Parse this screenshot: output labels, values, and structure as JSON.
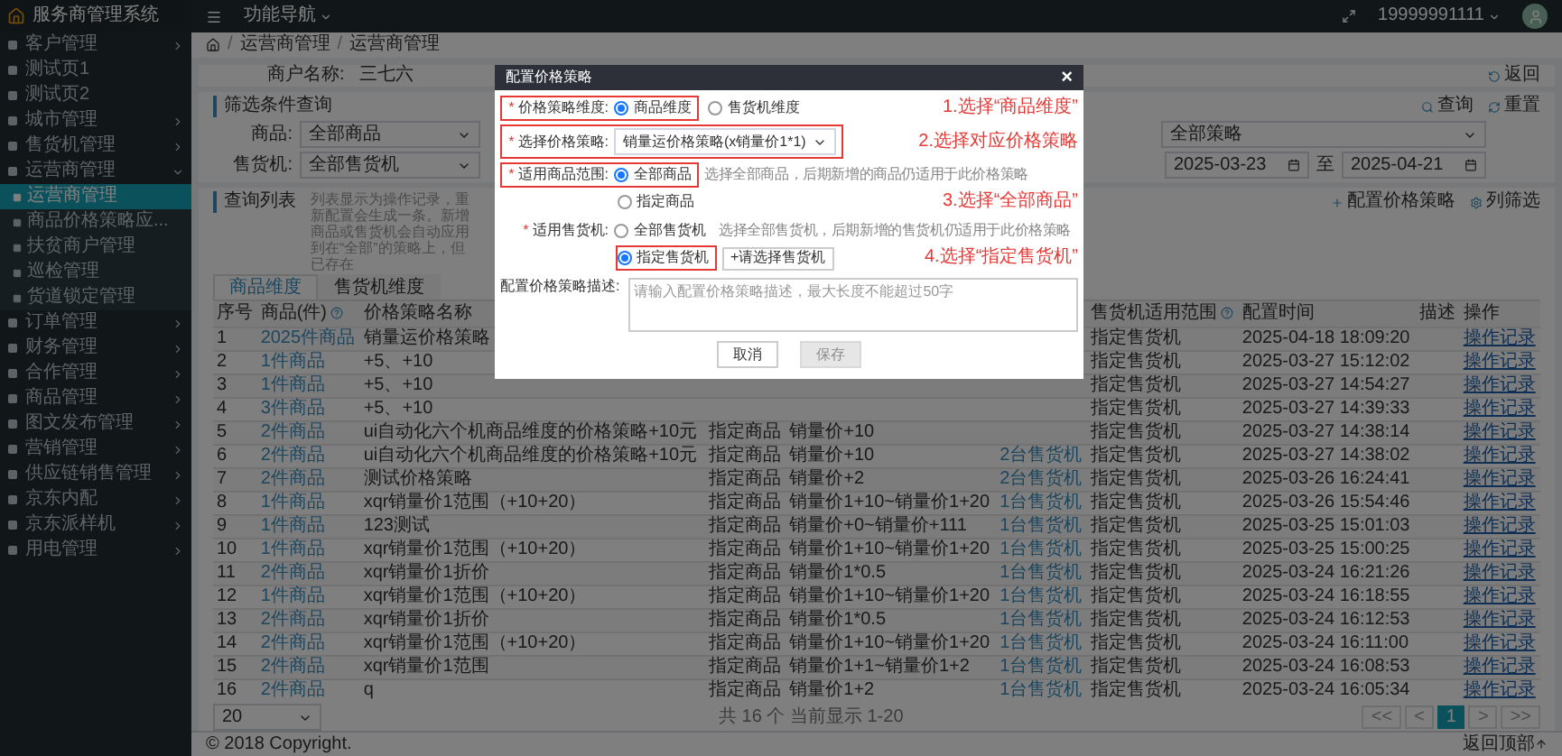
{
  "sidebar": {
    "title": "服务商管理系统",
    "items": [
      {
        "label": "客户管理",
        "selected": false,
        "expanded": false
      },
      {
        "label": "测试页1",
        "selected": false
      },
      {
        "label": "测试页2",
        "selected": false
      },
      {
        "label": "城市管理",
        "selected": false,
        "expanded": false
      },
      {
        "label": "售货机管理",
        "selected": false,
        "expanded": false
      },
      {
        "label": "运营商管理",
        "selected": false,
        "expanded": true,
        "children": [
          {
            "label": "运营商管理",
            "selected": true
          },
          {
            "label": "商品价格策略应...",
            "selected": false
          },
          {
            "label": "扶贫商户管理",
            "selected": false
          },
          {
            "label": "巡检管理",
            "selected": false
          },
          {
            "label": "货道锁定管理",
            "selected": false
          }
        ]
      },
      {
        "label": "订单管理",
        "selected": false,
        "expanded": false
      },
      {
        "label": "财务管理",
        "selected": false,
        "expanded": false
      },
      {
        "label": "合作管理",
        "selected": false,
        "expanded": false
      },
      {
        "label": "商品管理",
        "selected": false,
        "expanded": false
      },
      {
        "label": "图文发布管理",
        "selected": false,
        "expanded": false
      },
      {
        "label": "营销管理",
        "selected": false,
        "expanded": false
      },
      {
        "label": "供应链销售管理",
        "selected": false,
        "expanded": false
      },
      {
        "label": "京东内配",
        "selected": false,
        "expanded": false
      },
      {
        "label": "京东派样机",
        "selected": false,
        "expanded": false
      },
      {
        "label": "用电管理",
        "selected": false,
        "expanded": false
      }
    ]
  },
  "topbar": {
    "nav": "功能导航",
    "user": "19999991111"
  },
  "breadcrumb": [
    {
      "separator": "/",
      "label": "运营商管理"
    },
    {
      "separator": "/",
      "label": "运营商管理"
    }
  ],
  "merchant": {
    "label": "商户名称:",
    "value": "三七六",
    "back": "返回"
  },
  "filter": {
    "title": "筛选条件查询",
    "search": "查询",
    "reset": "重置",
    "goods_label": "商品:",
    "goods": "全部商品",
    "strategy": "全部策略",
    "machine_label": "售货机:",
    "machine": "全部售货机",
    "date_from": "2025-03-23",
    "date_sep": "至",
    "date_to": "2025-04-21"
  },
  "list": {
    "title": "查询列表",
    "note": "列表显示为操作记录，重新配置会生成一条。新增商品或售货机会自动应用到在“全部”的策略上，但已存在",
    "configure": "配置价格策略",
    "columns_button": "列筛选"
  },
  "tabs": [
    {
      "label": "商品维度",
      "selected": true
    },
    {
      "label": "售货机维度",
      "selected": false
    }
  ],
  "table": {
    "columns": [
      {
        "label": "序号",
        "help": false
      },
      {
        "label": "商品(件)",
        "help": true
      },
      {
        "label": "价格策略名称",
        "help": false
      },
      {},
      {},
      {},
      {
        "label": "售货机适用范围",
        "help": true
      },
      {
        "label": "配置时间",
        "help": false
      },
      {
        "label": "描述",
        "help": false
      },
      {
        "label": "操作",
        "help": false
      }
    ],
    "rows": [
      {
        "index": "1",
        "goods": "2025件商品",
        "name": "销量运价格策略",
        "scope": "指定售货机",
        "time": "2025-04-18 18:09:20",
        "action": "操作记录"
      },
      {
        "index": "2",
        "goods": "1件商品",
        "name": "+5、+10",
        "scope": "指定售货机",
        "time": "2025-03-27 15:12:02",
        "action": "操作记录"
      },
      {
        "index": "3",
        "goods": "1件商品",
        "name": "+5、+10",
        "scope": "指定售货机",
        "time": "2025-03-27 14:54:27",
        "action": "操作记录"
      },
      {
        "index": "4",
        "goods": "3件商品",
        "name": "+5、+10",
        "scope": "指定售货机",
        "time": "2025-03-27 14:39:33",
        "action": "操作记录"
      },
      {
        "index": "5",
        "goods": "2件商品",
        "name": "ui自动化六个机商品维度的价格策略+10元",
        "column_4": "指定商品",
        "column_5": "销量价+10",
        "scope": "指定售货机",
        "time": "2025-03-27 14:38:14",
        "action": "操作记录"
      },
      {
        "index": "6",
        "goods": "2件商品",
        "name": "ui自动化六个机商品维度的价格策略+10元",
        "column_4": "指定商品",
        "column_5": "销量价+10",
        "column_6": "2台售货机",
        "scope": "指定售货机",
        "time": "2025-03-27 14:38:02",
        "action": "操作记录"
      },
      {
        "index": "7",
        "goods": "2件商品",
        "name": "测试价格策略",
        "column_4": "指定商品",
        "column_5": "销量价+2",
        "column_6": "2台售货机",
        "scope": "指定售货机",
        "time": "2025-03-26 16:24:41",
        "action": "操作记录"
      },
      {
        "index": "8",
        "goods": "1件商品",
        "name": "xqr销量价1范围（+10+20）",
        "column_4": "指定商品",
        "column_5": "销量价1+10~销量价1+20",
        "column_6": "1台售货机",
        "scope": "指定售货机",
        "time": "2025-03-26 15:54:46",
        "action": "操作记录"
      },
      {
        "index": "9",
        "goods": "1件商品",
        "name": "123测试",
        "column_4": "指定商品",
        "column_5": "销量价+0~销量价+111",
        "column_6": "1台售货机",
        "scope": "指定售货机",
        "time": "2025-03-25 15:01:03",
        "action": "操作记录"
      },
      {
        "index": "10",
        "goods": "1件商品",
        "name": "xqr销量价1范围（+10+20）",
        "column_4": "指定商品",
        "column_5": "销量价1+10~销量价1+20",
        "column_6": "1台售货机",
        "scope": "指定售货机",
        "time": "2025-03-25 15:00:25",
        "action": "操作记录"
      },
      {
        "index": "11",
        "goods": "2件商品",
        "name": "xqr销量价1折价",
        "column_4": "指定商品",
        "column_5": "销量价1*0.5",
        "column_6": "1台售货机",
        "scope": "指定售货机",
        "time": "2025-03-24 16:21:26",
        "action": "操作记录"
      },
      {
        "index": "12",
        "goods": "1件商品",
        "name": "xqr销量价1范围（+10+20）",
        "column_4": "指定商品",
        "column_5": "销量价1+10~销量价1+20",
        "column_6": "1台售货机",
        "scope": "指定售货机",
        "time": "2025-03-24 16:18:55",
        "action": "操作记录"
      },
      {
        "index": "13",
        "goods": "2件商品",
        "name": "xqr销量价1折价",
        "column_4": "指定商品",
        "column_5": "销量价1*0.5",
        "column_6": "1台售货机",
        "scope": "指定售货机",
        "time": "2025-03-24 16:12:53",
        "action": "操作记录"
      },
      {
        "index": "14",
        "goods": "2件商品",
        "name": "xqr销量价1范围（+10+20）",
        "column_4": "指定商品",
        "column_5": "销量价1+10~销量价1+20",
        "column_6": "1台售货机",
        "scope": "指定售货机",
        "time": "2025-03-24 16:11:00",
        "action": "操作记录"
      },
      {
        "index": "15",
        "goods": "2件商品",
        "name": "xqr销量价1范围",
        "column_4": "指定商品",
        "column_5": "销量价1+1~销量价1+2",
        "column_6": "1台售货机",
        "scope": "指定售货机",
        "time": "2025-03-24 16:08:53",
        "action": "操作记录"
      },
      {
        "index": "16",
        "goods": "2件商品",
        "name": "q",
        "column_4": "指定商品",
        "column_5": "销量价1+2",
        "column_6": "1台售货机",
        "scope": "指定售货机",
        "time": "2025-03-24 16:05:34",
        "action": "操作记录"
      }
    ]
  },
  "pager": {
    "page_size": "20",
    "summary": "共 16 个 当前显示 1-20",
    "pages": [
      {
        "label": "<<",
        "selected": false
      },
      {
        "label": "<",
        "selected": false
      },
      {
        "label": "1",
        "selected": true
      },
      {
        "label": ">",
        "selected": false
      },
      {
        "label": ">>",
        "selected": false
      }
    ]
  },
  "footer": {
    "copyright": "© 2018 Copyright.",
    "top": "返回顶部"
  },
  "modal": {
    "title": "配置价格策略",
    "close": "×",
    "fields": [
      {
        "kind": "radio-row",
        "mark": "*",
        "label": "价格策略维度:",
        "highlighted": true,
        "annotation": "1.选择“商品维度”",
        "options": [
          {
            "label": "商品维度",
            "selected": true
          },
          {
            "label": "售货机维度",
            "selected": false
          }
        ]
      },
      {
        "kind": "select",
        "mark": "*",
        "label": "选择价格策略:",
        "highlighted": true,
        "annotation": "2.选择对应价格策略",
        "value": "销量运价格策略(x销量价1*1)"
      },
      {
        "kind": "radio-column",
        "mark": "*",
        "label": "适用商品范围:",
        "highlighted": true,
        "options": [
          {
            "label": "全部商品",
            "selected": true,
            "highlighted": false,
            "hint": "选择全部商品，后期新增的商品仍适用于此价格策略"
          },
          {
            "label": "指定商品",
            "selected": false,
            "highlighted": false,
            "annotation": "3.选择“全部商品”"
          }
        ]
      },
      {
        "kind": "radio-column",
        "mark": "*",
        "label": "适用售货机:",
        "highlighted": false,
        "options": [
          {
            "label": "全部售货机",
            "selected": false,
            "highlighted": false,
            "hint": "选择全部售货机，后期新增的售货机仍适用于此价格策略"
          },
          {
            "label": "指定售货机",
            "selected": true,
            "highlighted": true,
            "annotation": "4.选择“指定售货机”",
            "button": "+请选择售货机"
          }
        ]
      },
      {
        "kind": "textarea",
        "label": "配置价格策略描述:",
        "placeholder": "请输入配置价格策略描述，最大长度不能超过50字"
      }
    ],
    "buttons": [
      {
        "label": "取消",
        "disabled": false
      },
      {
        "label": "保存",
        "disabled": true
      }
    ]
  }
}
